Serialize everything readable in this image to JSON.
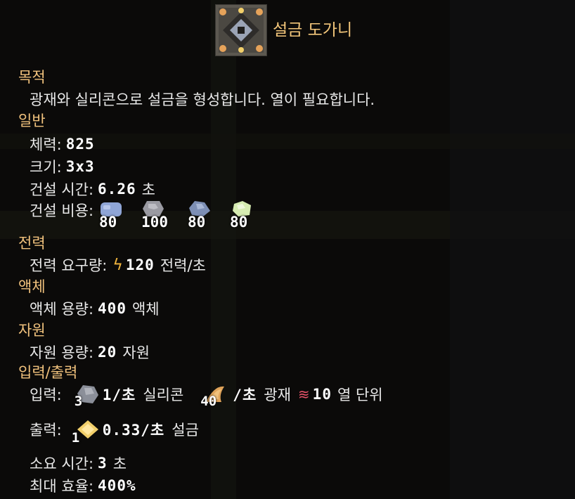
{
  "block": {
    "name": "설금 도가니",
    "icon": "crucible-block-icon"
  },
  "sections": {
    "purpose": {
      "title": "목적",
      "text": "광재와 실리콘으로 설금을 형성합니다. 열이 필요합니다."
    },
    "general": {
      "title": "일반",
      "health_label": "체력:",
      "health_value": "825",
      "size_label": "크기:",
      "size_value": "3x3",
      "build_time_label": "건설 시간:",
      "build_time_value": "6.26",
      "build_time_unit": "초",
      "build_cost_label": "건설 비용:",
      "build_cost": [
        {
          "amount": "80",
          "icon": "titanium-icon",
          "color": "#8fa5d6"
        },
        {
          "amount": "100",
          "icon": "graphite-icon",
          "color": "#9a9aa2"
        },
        {
          "amount": "80",
          "icon": "silicon-icon",
          "color": "#7d8fb5"
        },
        {
          "amount": "80",
          "icon": "plastanium-icon",
          "color": "#d6ecb2"
        }
      ]
    },
    "power": {
      "title": "전력",
      "use_label": "전력 요구량:",
      "use_value": "120",
      "use_unit": "전력/초"
    },
    "liquid": {
      "title": "액체",
      "capacity_label": "액체 용량:",
      "capacity_value": "400",
      "capacity_unit": "액체"
    },
    "items": {
      "title": "자원",
      "capacity_label": "자원 용량:",
      "capacity_value": "20",
      "capacity_unit": "자원"
    },
    "io": {
      "title": "입력/출력",
      "input_label": "입력:",
      "inputs": [
        {
          "count": "3",
          "rate": "1/초",
          "name": "실리콘",
          "icon": "silicon-icon",
          "color": "#8b8f99"
        },
        {
          "count": "40",
          "rate": "/초",
          "name": "광재",
          "icon": "slag-icon",
          "color": "#e0a45a"
        }
      ],
      "heat_value": "10",
      "heat_unit": "열 단위",
      "heat_icon": "heat-icon",
      "output_label": "출력:",
      "output": {
        "count": "1",
        "rate": "0.33/초",
        "name": "설금",
        "icon": "phase-fabric-icon",
        "color": "#f2cf6a"
      },
      "craft_time_label": "소요 시간:",
      "craft_time_value": "3",
      "craft_time_unit": "초",
      "efficiency_label": "최대 효율:",
      "efficiency_value": "400%"
    }
  },
  "colors": {
    "section": "#f1c27d",
    "title": "#f4c77b",
    "text": "#e9e9e9",
    "accent_power": "#f3b63d",
    "accent_heat": "#e8536a"
  }
}
